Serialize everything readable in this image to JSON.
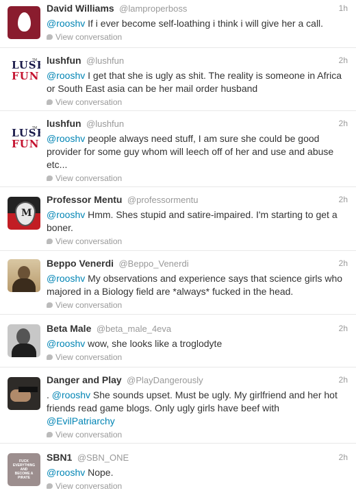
{
  "conversation_label": "View conversation",
  "tweets": [
    {
      "name": "David Williams",
      "handle": "@lamproperboss",
      "time": "1h",
      "mention": "@rooshv",
      "text": " If i ever become self-loathing i think i will give her a call."
    },
    {
      "name": "lushfun",
      "handle": "@lushfun",
      "time": "2h",
      "mention": "@rooshv",
      "text": " I get that she is ugly as shit. The reality is someone in Africa or South East asia can be her mail order husband"
    },
    {
      "name": "lushfun",
      "handle": "@lushfun",
      "time": "2h",
      "mention": "@rooshv",
      "text": " people always need stuff, I am sure she could be good provider for some guy whom will leech off of her and use and abuse etc..."
    },
    {
      "name": "Professor Mentu",
      "handle": "@professormentu",
      "time": "2h",
      "mention": "@rooshv",
      "text": " Hmm. Shes stupid and satire-impaired. I'm starting to get a boner."
    },
    {
      "name": "Beppo Venerdi",
      "handle": "@Beppo_Venerdi",
      "time": "2h",
      "mention": "@rooshv",
      "text": " My observations and experience says that science girls who majored in a Biology field are *always* fucked in the head."
    },
    {
      "name": "Beta Male",
      "handle": "@beta_male_4eva",
      "time": "2h",
      "mention": "@rooshv",
      "text": " wow, she looks like a troglodyte"
    },
    {
      "name": "Danger and Play",
      "handle": "@PlayDangerously",
      "time": "2h",
      "prefix": ". ",
      "mention": "@rooshv",
      "text": " She sounds upset. Must be ugly. My girlfriend and her hot friends read game blogs. Only ugly girls have beef with ",
      "mention2": "@EvilPatriarchy"
    },
    {
      "name": "SBN1",
      "handle": "@SBN_ONE",
      "time": "2h",
      "mention": "@rooshv",
      "text": " Nope."
    }
  ],
  "avatars": {
    "lushfun_top": "LUSH",
    "lushfun_bottom": "FUN",
    "lushfun_tm": "TM",
    "professor_letter": "M",
    "sbn_lines": [
      "FUCK",
      "EVERYTHING",
      "AND",
      "BECOME A",
      "PIRATE"
    ]
  }
}
